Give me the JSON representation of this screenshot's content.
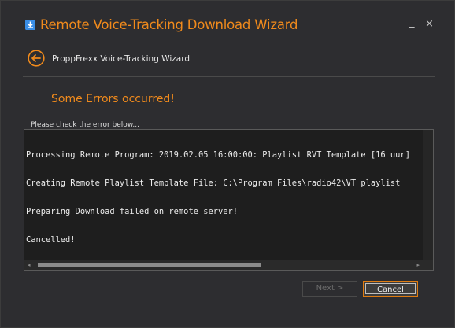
{
  "colors": {
    "accent": "#f08a1c",
    "window_bg": "#2d2d30",
    "log_bg": "#1e1e1e",
    "app_icon": "#3a8ee6"
  },
  "window": {
    "title": "Remote Voice-Tracking Download Wizard",
    "app_icon": "download-icon",
    "minimize_label": "_",
    "close_label": "×"
  },
  "header": {
    "back_icon": "back-arrow-circle-icon",
    "wizard_title": "ProppFrexx Voice-Tracking Wizard"
  },
  "main": {
    "status_heading": "Some Errors occurred!",
    "prompt": "Please check the error below...",
    "log_lines": [
      "Processing Remote Program: 2019.02.05 16:00:00: Playlist RVT Template [16 uur]",
      "Creating Remote Playlist Template File: C:\\Program Files\\radio42\\VT playlist",
      "Preparing Download failed on remote server!",
      "Cancelled!"
    ]
  },
  "footer": {
    "next_label": "Next >",
    "cancel_label": "Cancel"
  }
}
